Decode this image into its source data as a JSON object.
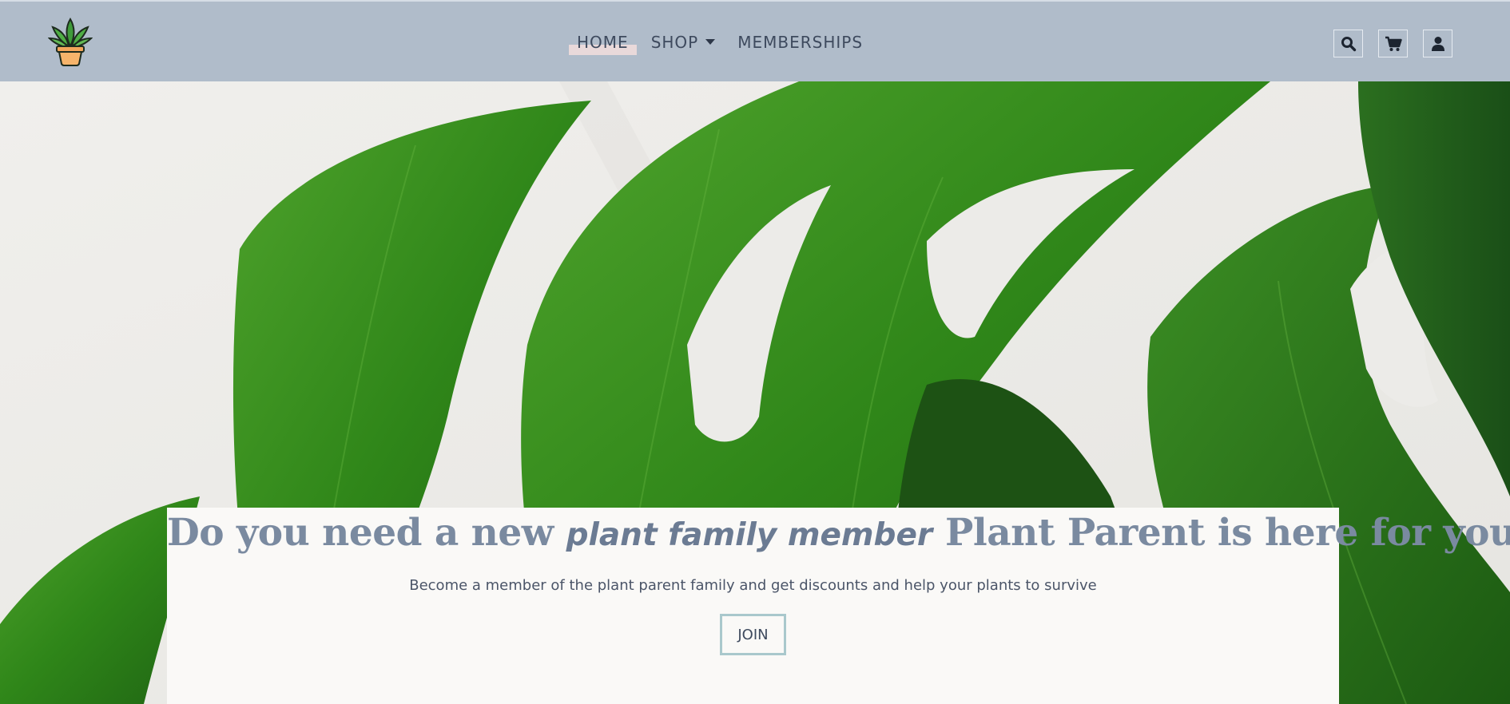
{
  "header": {
    "logo_icon": "potted-plant-logo-icon",
    "nav": [
      {
        "label": "HOME",
        "active": true
      },
      {
        "label": "SHOP",
        "has_dropdown": true
      },
      {
        "label": "MEMBERSHIPS"
      }
    ],
    "icons": [
      "search-icon",
      "cart-icon",
      "account-icon"
    ]
  },
  "hero": {
    "headline_part1": "Do you need a new ",
    "headline_script": "plant family member",
    "headline_part2": " Plant Parent is here for you",
    "subline": "Become a member of the plant parent family and get discounts and help your plants to survive",
    "cta_label": "JOIN"
  },
  "colors": {
    "header_bg": "#b0bcca",
    "headline": "#7a8aa0",
    "cta_border": "#a9c8cc",
    "card_bg": "#faf9f7",
    "leaf_green": "#2f7d1e"
  }
}
